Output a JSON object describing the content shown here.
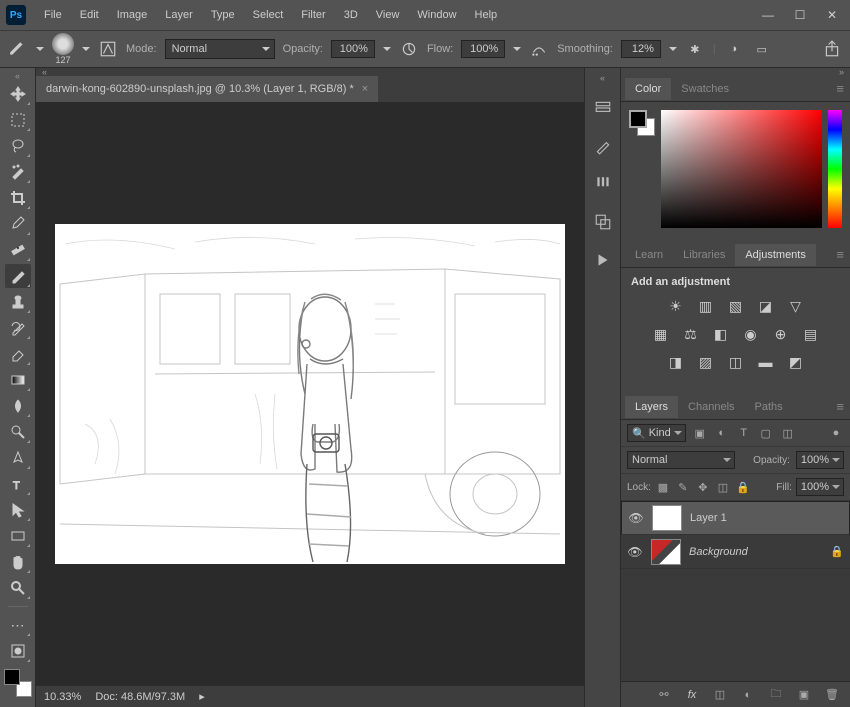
{
  "menu": [
    "File",
    "Edit",
    "Image",
    "Layer",
    "Type",
    "Select",
    "Filter",
    "3D",
    "View",
    "Window",
    "Help"
  ],
  "options": {
    "brush_size": "127",
    "mode_label": "Mode:",
    "mode_value": "Normal",
    "opacity_label": "Opacity:",
    "opacity_value": "100%",
    "flow_label": "Flow:",
    "flow_value": "100%",
    "smoothing_label": "Smoothing:",
    "smoothing_value": "12%"
  },
  "document": {
    "tab_title": "darwin-kong-602890-unsplash.jpg @ 10.3% (Layer 1, RGB/8) *",
    "zoom_text": "10.33%",
    "stats": "Doc: 48.6M/97.3M"
  },
  "panels": {
    "color_tab": "Color",
    "swatches_tab": "Swatches",
    "learn_tab": "Learn",
    "libraries_tab": "Libraries",
    "adjustments_tab": "Adjustments",
    "adjust_title": "Add an adjustment",
    "layers_tab": "Layers",
    "channels_tab": "Channels",
    "paths_tab": "Paths"
  },
  "layers": {
    "kind_label": "Kind",
    "blend_mode": "Normal",
    "opacity_label": "Opacity:",
    "opacity_value": "100%",
    "lock_label": "Lock:",
    "fill_label": "Fill:",
    "fill_value": "100%",
    "items": [
      {
        "name": "Layer 1",
        "locked": false
      },
      {
        "name": "Background",
        "locked": true
      }
    ]
  }
}
